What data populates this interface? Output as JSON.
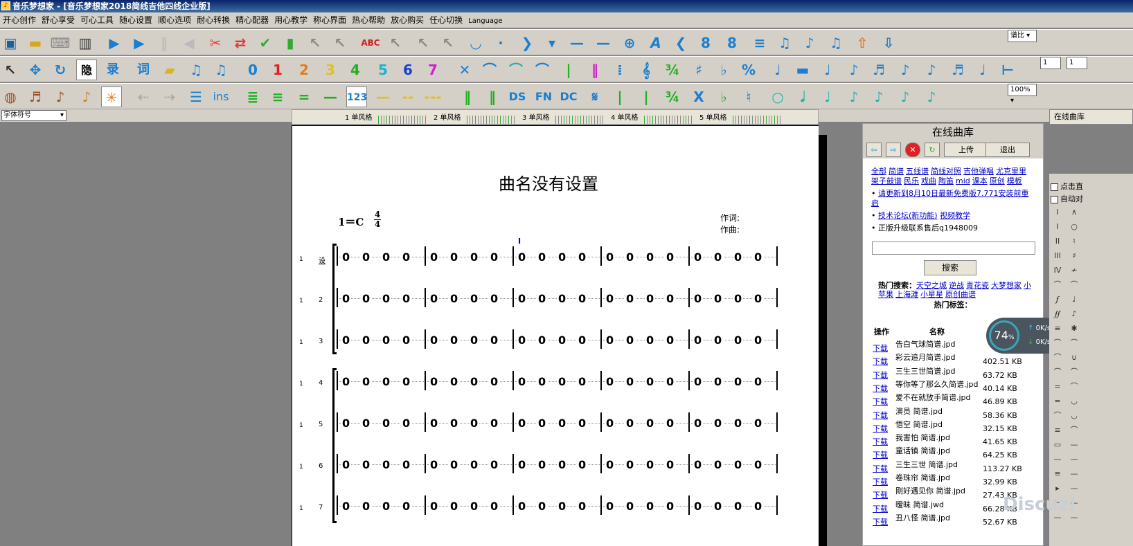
{
  "window": {
    "title": "音乐梦想家 - [音乐梦想家2018简线吉他四线企业版]"
  },
  "menu": [
    "开心创作",
    "舒心享受",
    "可心工具",
    "随心设置",
    "顺心选项",
    "耐心转换",
    "精心配器",
    "用心教学",
    "称心界面",
    "热心帮助",
    "放心购买",
    "任心切换",
    "Language"
  ],
  "toolbar1": {
    "ratio_label": "谱比"
  },
  "toolbar2": {
    "num1": "1",
    "num2": "1",
    "digits": [
      "0",
      "1",
      "2",
      "3",
      "4",
      "5",
      "6",
      "7"
    ],
    "word1": "词",
    "word2": "隐",
    "word3": "录"
  },
  "toolbar3": {
    "zoom": "100%",
    "ins_label": "ins",
    "label_123": "123",
    "ds": "DS",
    "fn": "FN",
    "dc": "DC"
  },
  "font_select": "字体符号",
  "ruler": {
    "labels": [
      "1 单风格",
      "2 单风格",
      "3 单风格",
      "4 单风格",
      "5 单风格"
    ]
  },
  "score": {
    "title": "曲名没有设置",
    "key": "1＝C",
    "time_top": "4",
    "time_bottom": "4",
    "lyricist": "作词:",
    "composer": "作曲:",
    "cursor": "I",
    "first_label": "设",
    "row_prefix": "1",
    "rows": [
      "设",
      "2",
      "3",
      "4",
      "5",
      "6",
      "7"
    ],
    "measure": "0  0  0  0"
  },
  "side": {
    "header": "在线曲库",
    "upload": "上传",
    "exit": "退出",
    "categories": [
      "全部",
      "简谱",
      "五线谱",
      "简线对照",
      "吉他弹唱",
      "尤克里里",
      "架子鼓谱",
      "民乐",
      "戏曲",
      "陶笛",
      "mid",
      "课本",
      "原创",
      "模板"
    ],
    "notice1_a": "请更新到8月10日最新免费版7.771安装前重启",
    "notice2_a": "技术论坛(新功能)",
    "notice2_b": "视频教学",
    "notice3": "正版升级联系售后q1948009",
    "search_btn": "搜索",
    "hot_search_label": "热门搜索：",
    "hot_searches": [
      "天空之城",
      "逆战",
      "青花瓷",
      "大梦想家",
      "小苹果",
      "上海滩",
      "小星星",
      "原创曲谱"
    ],
    "hot_tags": "热门标签：",
    "col_op": "操作",
    "col_name": "名称",
    "download": "下载",
    "files": [
      {
        "name": "告白气球简谱.jpd",
        "size": ""
      },
      {
        "name": "彩云追月简谱.jpd",
        "size": "402.51 KB"
      },
      {
        "name": "三生三世简谱.jpd",
        "size": "63.72 KB"
      },
      {
        "name": "等你等了那么久简谱.jpd",
        "size": "40.14 KB"
      },
      {
        "name": "爱不在就放手简谱.jpd",
        "size": "46.89 KB"
      },
      {
        "name": "演员 简谱.jpd",
        "size": "58.36 KB"
      },
      {
        "name": "悟空 简谱.jpd",
        "size": "32.15 KB"
      },
      {
        "name": "我害怕 简谱.jpd",
        "size": "41.65 KB"
      },
      {
        "name": "童话镇 简谱.jpd",
        "size": "64.25 KB"
      },
      {
        "name": "三生三世 简谱.jpd",
        "size": "113.27 KB"
      },
      {
        "name": "卷珠帘 简谱.jpd",
        "size": "32.99 KB"
      },
      {
        "name": "刚好遇见你 简谱.jpd",
        "size": "27.43 KB"
      },
      {
        "name": "暧昧 简谱.jwd",
        "size": "66.28 KB"
      },
      {
        "name": "丑八怪 简谱.jpd",
        "size": "52.67 KB"
      }
    ]
  },
  "net": {
    "percent": "74",
    "percent_sign": "%",
    "up": "0K/s",
    "down": "0K/s"
  },
  "right": {
    "online_btn": "在线曲库",
    "cb1": "点击直",
    "cb2": "自动对"
  },
  "watermark": "Discuz!"
}
